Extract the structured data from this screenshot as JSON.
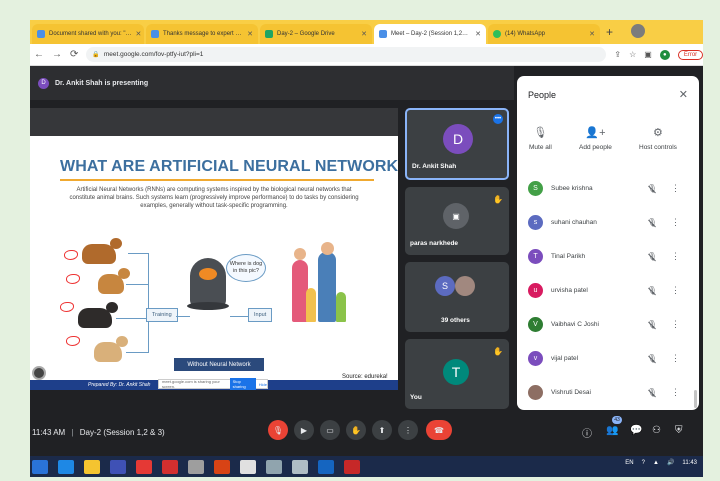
{
  "browser": {
    "tabs": [
      {
        "label": "Document shared with you: \"…",
        "active": false
      },
      {
        "label": "Thanks message to expert …",
        "active": false
      },
      {
        "label": "Day-2 – Google Drive",
        "active": false
      },
      {
        "label": "Meet – Day-2 (Session 1,2…",
        "active": true
      },
      {
        "label": "(14) WhatsApp",
        "active": false
      }
    ],
    "url": "meet.google.com/fov-ptfy-iut?pli=1",
    "error_label": "Error"
  },
  "meeting": {
    "presenting_initial": "D",
    "presenting_text": "Dr. Ankit Shah is presenting",
    "time": "11:43 AM",
    "separator": "|",
    "title": "Day-2 (Session 1,2 & 3)",
    "participant_badge": "43"
  },
  "slide": {
    "title": "WHAT ARE ARTIFICIAL NEURAL NETWORKS?",
    "description": "Artificial Neural Networks (RNNs) are computing systems inspired by the biological neural networks that constitute animal brains. Such systems learn (progressively improve performance) to do tasks by considering examples, generally without task-specific programming.",
    "training_label": "Training",
    "input_label": "Input",
    "bubble_text": "Where is dog in this pic?",
    "nn_label": "Without Neural Network",
    "source": "Source: edureka!",
    "prepared_by": "Prepared By: Dr. Ankit Shah",
    "share_notice": "meet.google.com is sharing your screen.",
    "stop_sharing": "Stop sharing",
    "hide": "Hide"
  },
  "tiles": [
    {
      "name": "Dr. Ankit Shah",
      "initial": "D",
      "color": "#7b4dbd"
    },
    {
      "name": "paras narkhede",
      "initial": "",
      "color": "#5f6368"
    },
    {
      "name": "39 others",
      "initial": "S",
      "color": "#5c6bc0"
    },
    {
      "name": "You",
      "initial": "T",
      "color": "#00897b"
    }
  ],
  "people_panel": {
    "title": "People",
    "actions": [
      {
        "label": "Mute all",
        "icon": "mic-off-icon"
      },
      {
        "label": "Add people",
        "icon": "add-person-icon"
      },
      {
        "label": "Host controls",
        "icon": "host-controls-icon"
      }
    ],
    "participants": [
      {
        "name": "Subee krishna",
        "initial": "S",
        "color": "#43a047"
      },
      {
        "name": "suhani chauhan",
        "initial": "s",
        "color": "#5c6bc0"
      },
      {
        "name": "Tinal Parikh",
        "initial": "T",
        "color": "#7b4dbd"
      },
      {
        "name": "urvisha patel",
        "initial": "u",
        "color": "#d81b60"
      },
      {
        "name": "Vaibhavi C Joshi",
        "initial": "V",
        "color": "#2e7d32"
      },
      {
        "name": "vijal patel",
        "initial": "v",
        "color": "#7b4dbd"
      },
      {
        "name": "Vishruti Desai",
        "initial": "",
        "color": "#8d6e63"
      }
    ]
  },
  "taskbar": {
    "lang": "EN",
    "clock": "11:43"
  }
}
